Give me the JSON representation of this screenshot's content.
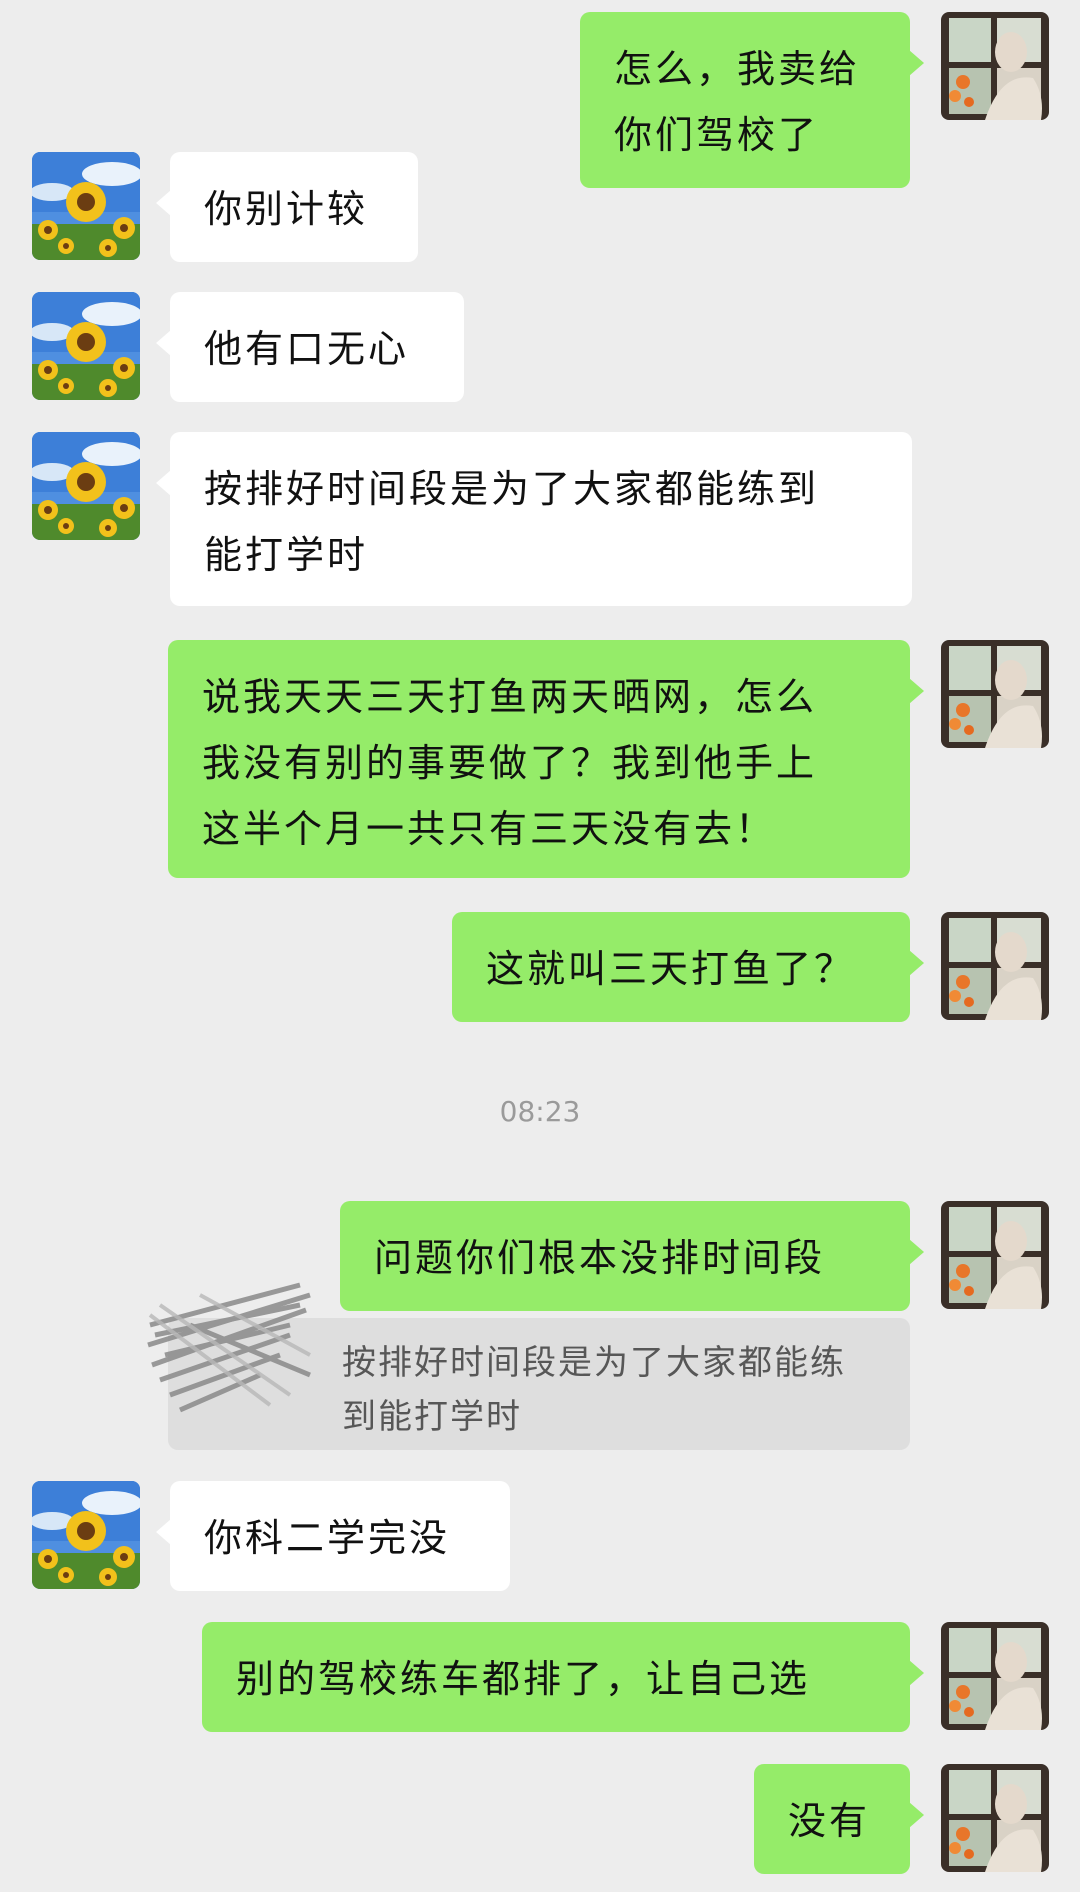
{
  "messages": [
    {
      "side": "me",
      "text": "怎么，我卖给你们驾校了"
    },
    {
      "side": "other",
      "text": "你别计较"
    },
    {
      "side": "other",
      "text": "他有口无心"
    },
    {
      "side": "other",
      "text": "按排好时间段是为了大家都能练到\n能打学时"
    },
    {
      "side": "me",
      "text": "说我天天三天打鱼两天晒网，怎么\n我没有别的事要做了？我到他手上\n这半个月一共只有三天没有去！"
    },
    {
      "side": "me",
      "text": "这就叫三天打鱼了？"
    },
    {
      "side": "me",
      "text": "问题你们根本没排时间段"
    },
    {
      "side": "other",
      "text": "你科二学完没"
    },
    {
      "side": "me",
      "text": "别的驾校练车都排了，让自己选"
    },
    {
      "side": "me",
      "text": "没有"
    }
  ],
  "timestamp": "08:23",
  "quote": {
    "text": "按排好时间段是为了大家都能练\n到能打学时"
  },
  "avatars": {
    "other": "sunflower-avatar",
    "me": "window-portrait-avatar"
  }
}
